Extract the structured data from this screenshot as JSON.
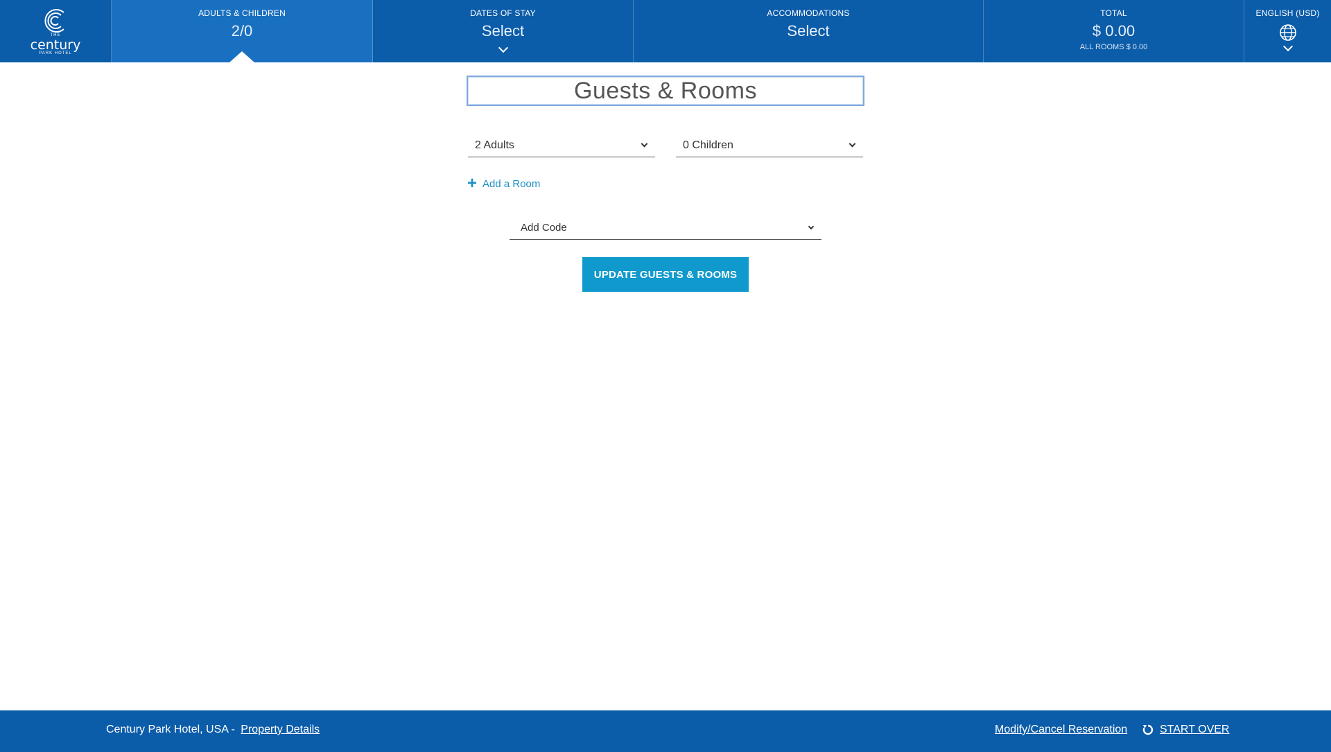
{
  "header": {
    "logo": {
      "the": "THE",
      "word": "century",
      "sub": "PARK HOTEL"
    },
    "adults_children": {
      "label": "ADULTS & CHILDREN",
      "value": "2/0"
    },
    "dates": {
      "label": "DATES OF STAY",
      "value": "Select"
    },
    "accommodations": {
      "label": "ACCOMMODATIONS",
      "value": "Select"
    },
    "total": {
      "label": "TOTAL",
      "value": "$ 0.00",
      "sub": "ALL ROOMS $ 0.00"
    },
    "language": {
      "label": "ENGLISH (USD)"
    }
  },
  "main": {
    "title": "Guests & Rooms",
    "adults_select": "2 Adults",
    "children_select": "0 Children",
    "add_room": "Add a Room",
    "code_select": "Add Code",
    "update_button": "UPDATE GUESTS & ROOMS"
  },
  "footer": {
    "hotel": "Century Park Hotel, USA -",
    "property_details": "Property Details",
    "modify_cancel": "Modify/Cancel Reservation",
    "start_over": "START OVER"
  },
  "colors": {
    "header_bg": "#0b5ca9",
    "active_cell": "#1a70c0",
    "accent": "#0f99cc",
    "link": "#1a8fc4"
  }
}
